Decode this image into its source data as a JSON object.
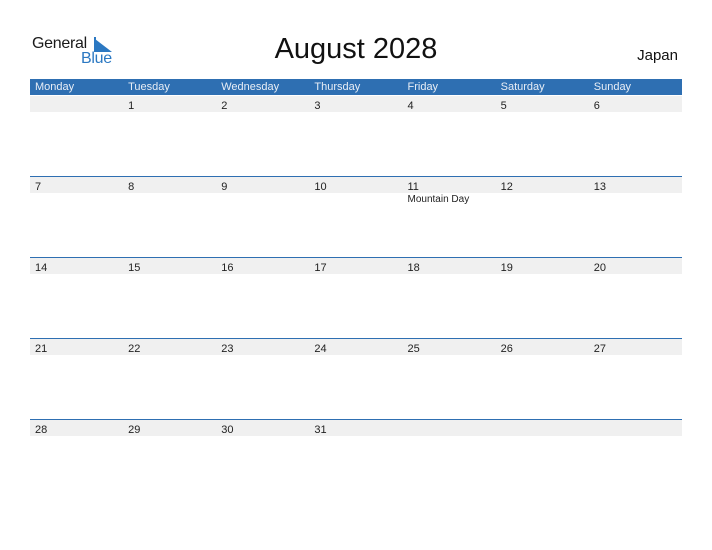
{
  "brand": {
    "line1": "General",
    "line2": "Blue",
    "accent": "#2b78c2"
  },
  "title": "August 2028",
  "country": "Japan",
  "colors": {
    "header_bg": "#2e6fb2",
    "strip_bg": "#f0f0f0"
  },
  "weekdays": [
    "Monday",
    "Tuesday",
    "Wednesday",
    "Thursday",
    "Friday",
    "Saturday",
    "Sunday"
  ],
  "weeks": [
    {
      "days": [
        "",
        "1",
        "2",
        "3",
        "4",
        "5",
        "6"
      ],
      "holidays": [
        "",
        "",
        "",
        "",
        "",
        "",
        ""
      ]
    },
    {
      "days": [
        "7",
        "8",
        "9",
        "10",
        "11",
        "12",
        "13"
      ],
      "holidays": [
        "",
        "",
        "",
        "",
        "Mountain Day",
        "",
        ""
      ]
    },
    {
      "days": [
        "14",
        "15",
        "16",
        "17",
        "18",
        "19",
        "20"
      ],
      "holidays": [
        "",
        "",
        "",
        "",
        "",
        "",
        ""
      ]
    },
    {
      "days": [
        "21",
        "22",
        "23",
        "24",
        "25",
        "26",
        "27"
      ],
      "holidays": [
        "",
        "",
        "",
        "",
        "",
        "",
        ""
      ]
    },
    {
      "days": [
        "28",
        "29",
        "30",
        "31",
        "",
        "",
        ""
      ],
      "holidays": [
        "",
        "",
        "",
        "",
        "",
        "",
        ""
      ]
    }
  ]
}
